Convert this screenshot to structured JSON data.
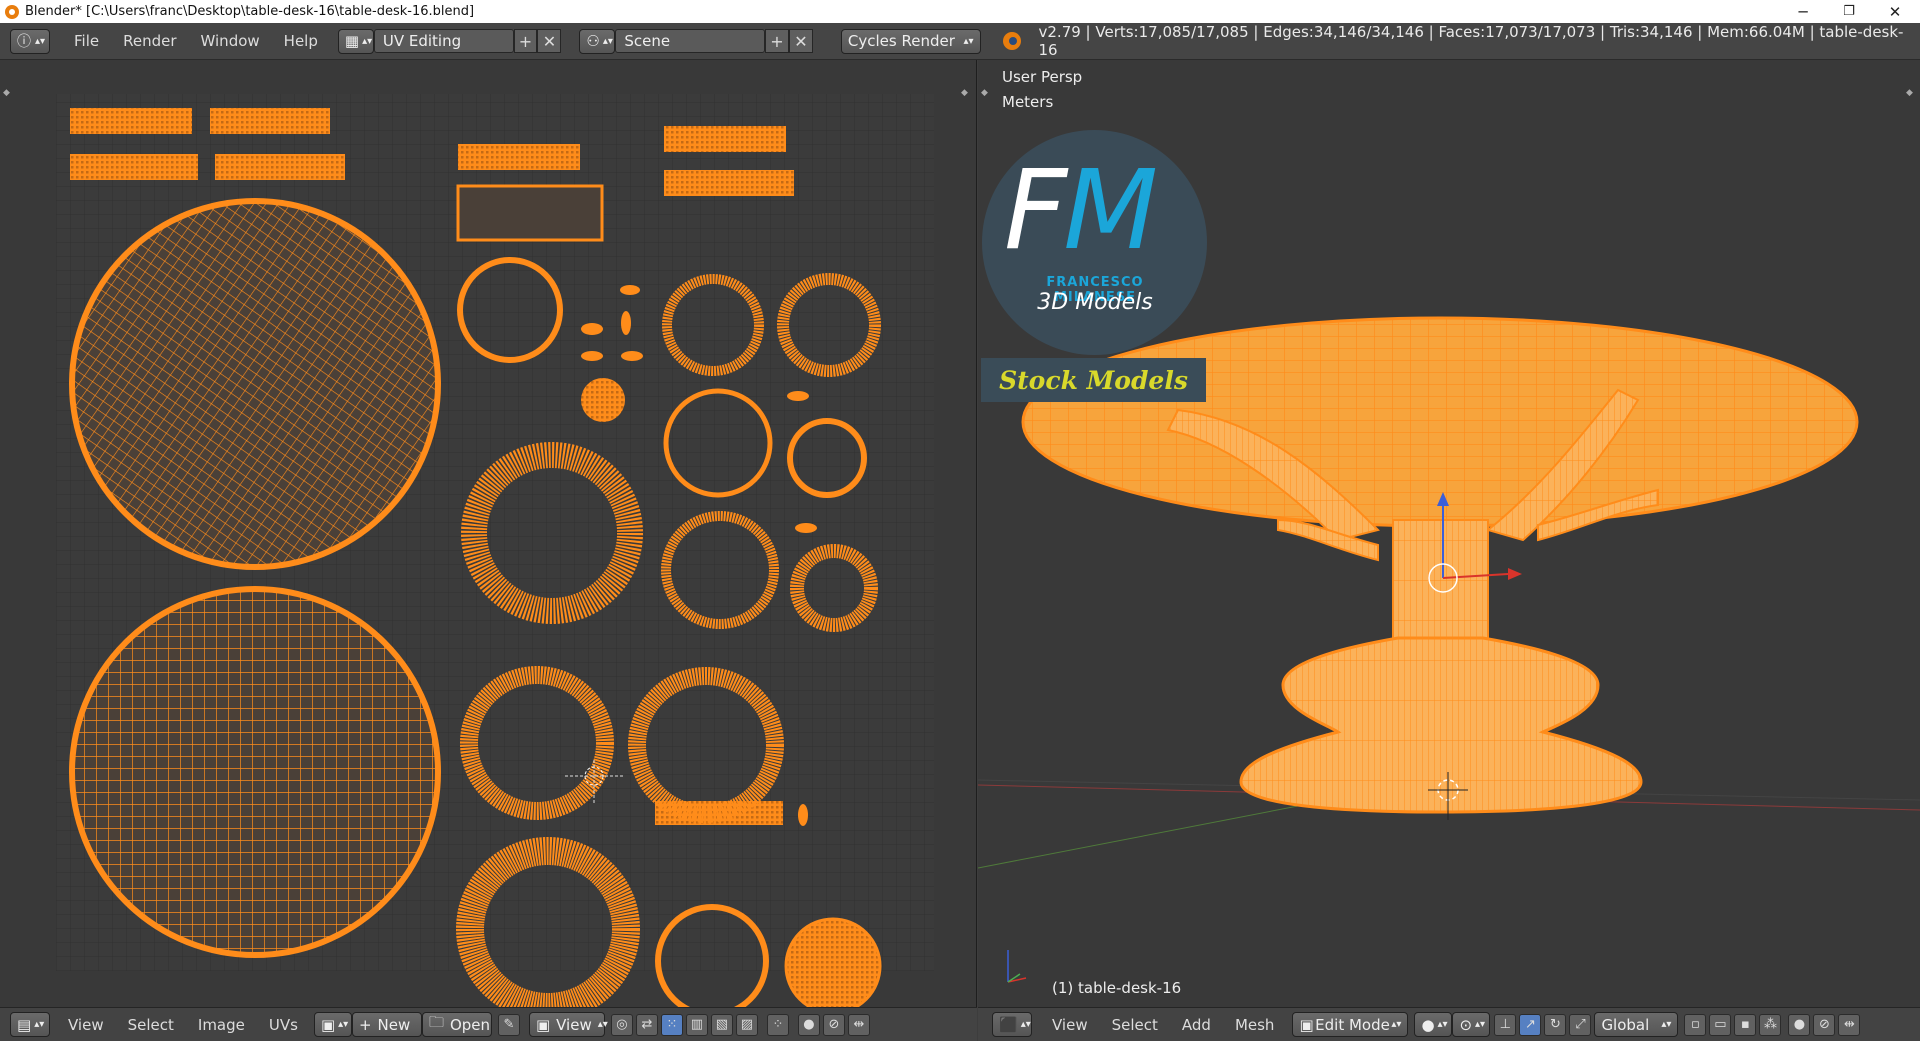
{
  "window": {
    "title": "Blender* [C:\\Users\\franc\\Desktop\\table-desk-16\\table-desk-16.blend]",
    "minimize": "─",
    "restore": "❐",
    "close": "✕"
  },
  "info_header": {
    "menus": [
      "File",
      "Render",
      "Window",
      "Help"
    ],
    "screen_layout": "UV Editing",
    "scene": "Scene",
    "render_engine": "Cycles Render",
    "stats": "v2.79 | Verts:17,085/17,085 | Edges:34,146/34,146 | Faces:17,073/17,073 | Tris:34,146 | Mem:66.04M | table-desk-16"
  },
  "uv_editor": {
    "header": {
      "menus": [
        "View",
        "Select",
        "Image",
        "UVs"
      ],
      "new_label": "New",
      "open_label": "Open",
      "view_label": "View"
    }
  },
  "viewport": {
    "view_name": "User Persp",
    "units": "Meters",
    "object_info": "(1) table-desk-16",
    "header": {
      "menus": [
        "View",
        "Select",
        "Add",
        "Mesh"
      ],
      "mode": "Edit Mode",
      "orientation": "Global"
    },
    "watermark": {
      "monogram": "FM",
      "author": "FRANCESCO MILANESE",
      "line": "3D Models",
      "badge": "Stock Models"
    }
  },
  "colors": {
    "uv_orange": "#ff8c1a",
    "grid_bg": "#3a3a3a",
    "watermark_blue": "#1ba6d9",
    "badge_yellow": "#d9d92b"
  }
}
